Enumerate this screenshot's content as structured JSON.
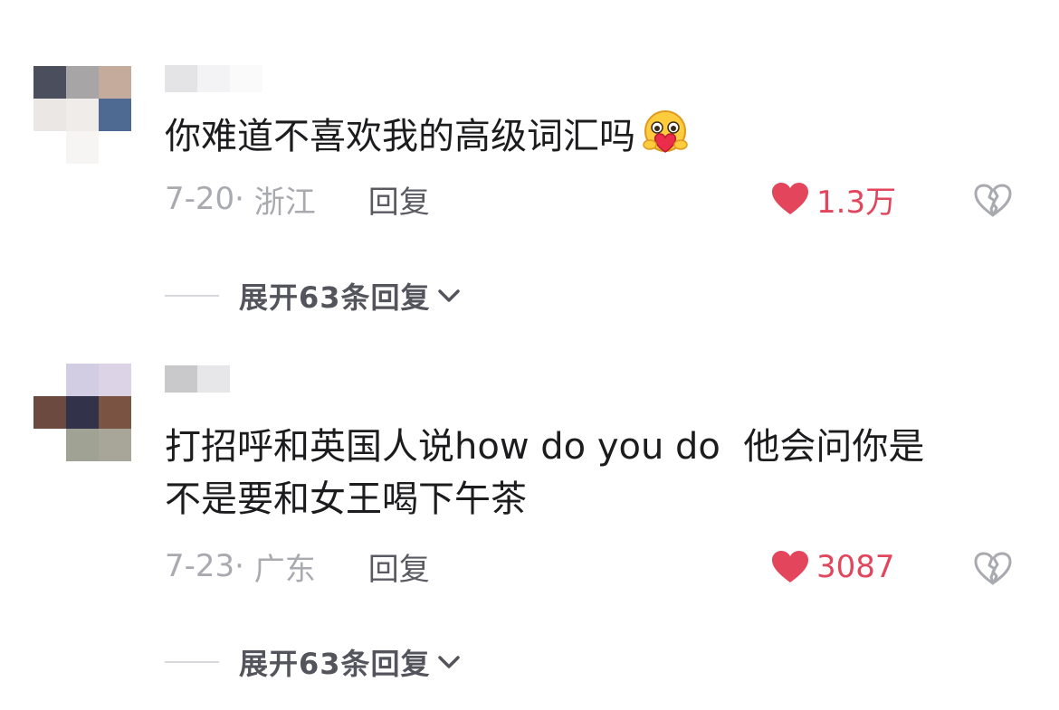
{
  "comments": [
    {
      "text": "你难道不喜欢我的高级词汇吗",
      "emoji_icon": "hug-heart-emoji-icon",
      "date": "7-20",
      "location": "浙江",
      "reply_label": "回复",
      "likes": "1.3万",
      "expand_label": "展开63条回复",
      "avatar_colors": [
        "#4b4e5c",
        "#a8a5a6",
        "#c5ab9c",
        "#ebe7e5",
        "#efece9",
        "#4f6a92",
        "#ffffff",
        "#f7f4f4",
        "#ffffff"
      ],
      "username_colors": [
        "#e4e4e6",
        "#f3f3f5",
        "#fafafb"
      ]
    },
    {
      "text_line1": "打招呼和英国人说how do you do  他会问你是",
      "text_line2": "不是要和女王喝下午茶",
      "date": "7-23",
      "location": "广东",
      "reply_label": "回复",
      "likes": "3087",
      "expand_label": "展开63条回复",
      "avatar_colors": [
        "#ffffff",
        "#d3cde3",
        "#ddd3e6",
        "#6c4a40",
        "#32324a",
        "#7b5342",
        "#ffffff",
        "#a0a293",
        "#a7a699"
      ],
      "username_colors": [
        "#c9c9cc",
        "#e7e7ea",
        "#ffffff"
      ]
    }
  ],
  "colors": {
    "like_red": "#e2455c",
    "meta_grey": "#a9aab0",
    "text_dark": "#1c1c1e"
  }
}
